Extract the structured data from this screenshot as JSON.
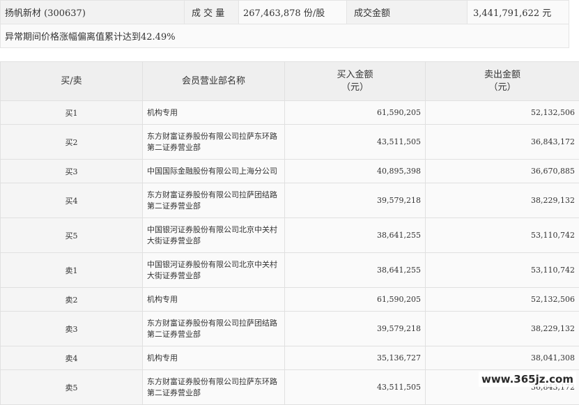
{
  "summary": {
    "stock": "扬帆新材 (300637)",
    "volume_label": "成 交 量",
    "volume_value": "267,463,878 份/股",
    "amount_label": "成交金额",
    "amount_value": "3,441,791,622 元",
    "note": "异常期间价格涨幅偏离值累计达到42.49%"
  },
  "table": {
    "headers": {
      "side": "买/卖",
      "dept": "会员营业部名称",
      "buy": "买入金额",
      "buy_unit": "（元）",
      "sell": "卖出金额",
      "sell_unit": "（元）"
    },
    "rows": [
      {
        "side": "买1",
        "dept": "机构专用",
        "buy": "61,590,205",
        "sell": "52,132,506"
      },
      {
        "side": "买2",
        "dept": "东方财富证券股份有限公司拉萨东环路第二证券营业部",
        "buy": "43,511,505",
        "sell": "36,843,172"
      },
      {
        "side": "买3",
        "dept": "中国国际金融股份有限公司上海分公司",
        "buy": "40,895,398",
        "sell": "36,670,885"
      },
      {
        "side": "买4",
        "dept": "东方财富证券股份有限公司拉萨团结路第二证券营业部",
        "buy": "39,579,218",
        "sell": "38,229,132"
      },
      {
        "side": "买5",
        "dept": "中国银河证券股份有限公司北京中关村大街证券营业部",
        "buy": "38,641,255",
        "sell": "53,110,742"
      },
      {
        "side": "卖1",
        "dept": "中国银河证券股份有限公司北京中关村大街证券营业部",
        "buy": "38,641,255",
        "sell": "53,110,742"
      },
      {
        "side": "卖2",
        "dept": "机构专用",
        "buy": "61,590,205",
        "sell": "52,132,506"
      },
      {
        "side": "卖3",
        "dept": "东方财富证券股份有限公司拉萨团结路第二证券营业部",
        "buy": "39,579,218",
        "sell": "38,229,132"
      },
      {
        "side": "卖4",
        "dept": "机构专用",
        "buy": "35,136,727",
        "sell": "38,041,308"
      },
      {
        "side": "卖5",
        "dept": "东方财富证券股份有限公司拉萨东环路第二证券营业部",
        "buy": "43,511,505",
        "sell": "36,843,172"
      }
    ]
  },
  "watermark": "www.365jz.com"
}
